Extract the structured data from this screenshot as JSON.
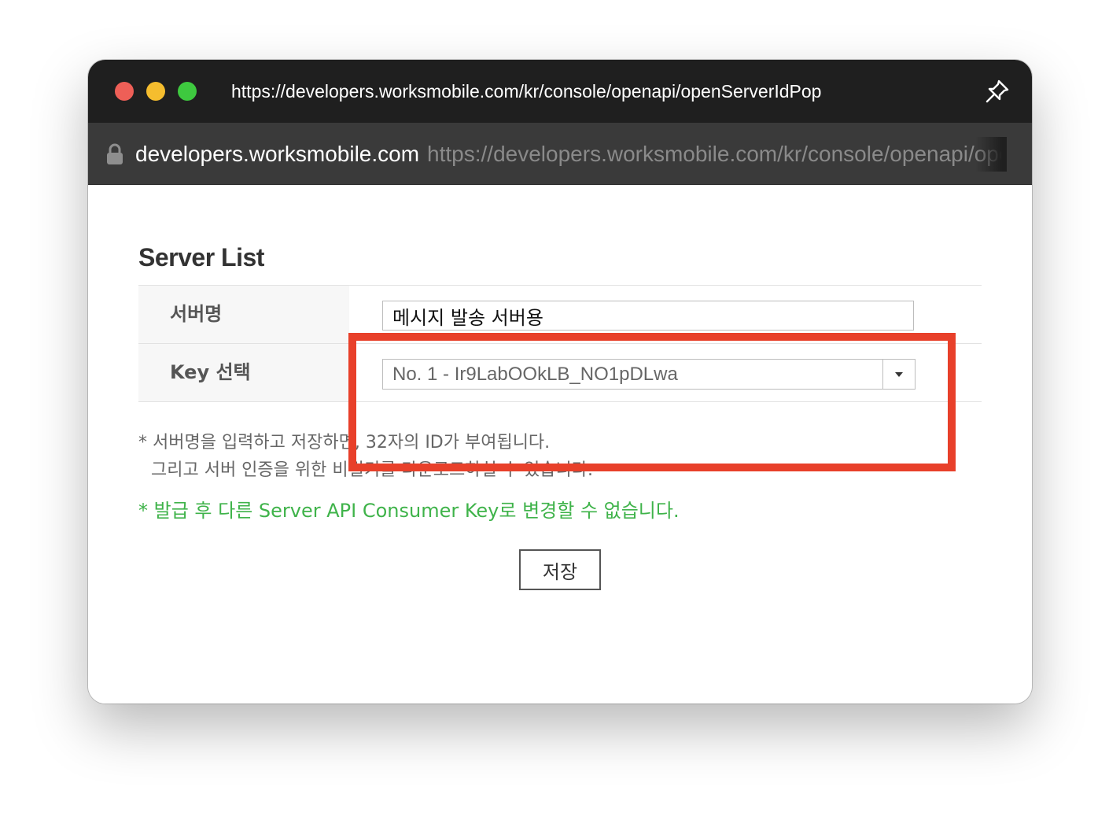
{
  "window": {
    "title": "https://developers.worksmobile.com/kr/console/openapi/openServerIdPop"
  },
  "addressbar": {
    "host": "developers.worksmobile.com",
    "url": "https://developers.worksmobile.com/kr/console/openapi/openServerIdPop"
  },
  "icons": {
    "window_controls": [
      "close-light",
      "minimize-light",
      "zoom-light"
    ],
    "pin": "pin-icon",
    "lock": "lock-icon",
    "select_arrow": "caret-down-icon"
  },
  "colors": {
    "highlight": "#e8402a",
    "notice_green": "#3fb34a",
    "titlebar": "#1f1f1f",
    "addressbar": "#3a3a3a"
  },
  "page": {
    "section_title": "Server List",
    "rows": [
      {
        "label": "서버명",
        "value": "메시지 발송 서버용"
      },
      {
        "label": "Key 선택",
        "value": "No. 1 - Ir9LabOOkLB_NO1pDLwa"
      }
    ],
    "notes": [
      "* 서버명을 입력하고 저장하면, 32자의 ID가 부여됩니다.",
      "그리고 서버 인증을 위한 비밀키를 다운로드하실 수 있습니다."
    ],
    "warning": "* 발급 후 다른 Server API Consumer Key로 변경할 수 없습니다.",
    "save_label": "저장"
  }
}
